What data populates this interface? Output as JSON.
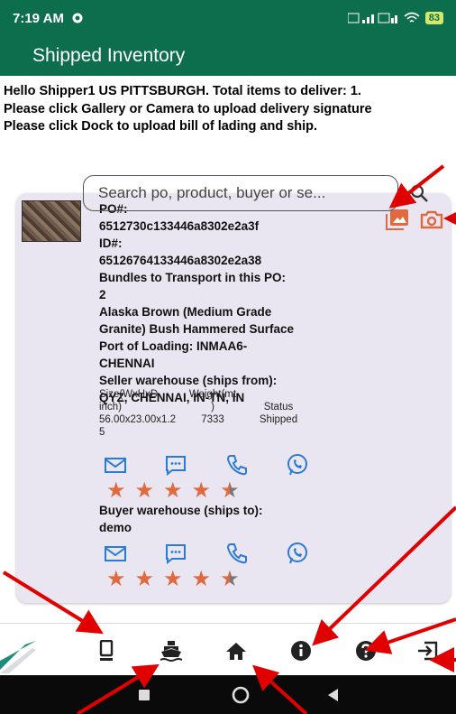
{
  "status_bar": {
    "time": "7:19 AM",
    "battery": "83"
  },
  "app": {
    "title": "Shipped Inventory"
  },
  "intro": {
    "line1": "Hello Shipper1 US PITTSBURGH. Total items to deliver: 1.",
    "line2": "Please click Gallery or Camera to upload delivery signature",
    "line3": "Please click Dock to upload bill of lading and ship."
  },
  "search": {
    "placeholder": "Search po, product, buyer or se..."
  },
  "item": {
    "po_label": "PO#:",
    "po_value": "6512730c133446a8302e2a3f",
    "id_label": "ID#:",
    "id_value": "65126764133446a8302e2a38",
    "bundles_label": "Bundles to Transport in this PO:",
    "bundles_value": "2",
    "product_line1": "Alaska Brown (Medium Grade",
    "product_line2": "Granite) Bush Hammered Surface",
    "port_line1": "Port of Loading: INMAA6-",
    "port_line2": "CHENNAI",
    "seller_label": "Seller warehouse (ships from):",
    "seller_value": "QYZ, CHENNAI, IN-TN, IN",
    "size_label1": "Size(WxHxD",
    "size_label2": "inch)",
    "size_value1": "56.00x23.00x1.2",
    "size_value2": "5",
    "weight_label1": "Weight(mt",
    "weight_label2": ")",
    "weight_value": "7333",
    "status_label": "Status",
    "status_value": "Shipped",
    "seller_rating": 4.5,
    "buyer_label": "Buyer warehouse (ships to):",
    "buyer_value": "demo",
    "buyer_rating": 4.5
  },
  "icons": {
    "gallery": "gallery-icon",
    "camera": "camera-icon",
    "email": "email-icon",
    "sms": "sms-icon",
    "phone": "phone-icon",
    "whatsapp": "whatsapp-icon",
    "inventory": "device-icon",
    "dock": "ship-icon",
    "home": "home-icon",
    "info": "info-icon",
    "help": "help-icon",
    "logout": "logout-icon"
  },
  "colors": {
    "app_bar": "#0d6e4e",
    "accent": "#e0693f",
    "contact": "#2a7bd6",
    "card": "#eae6f1",
    "arrow": "#e00000"
  }
}
